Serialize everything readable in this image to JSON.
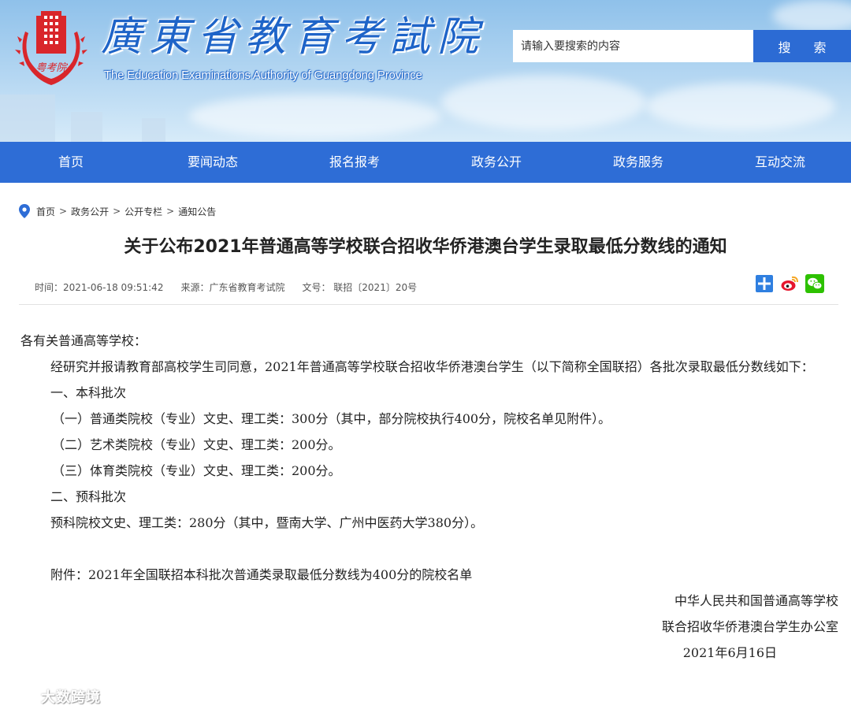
{
  "header": {
    "logo_cn": "廣東省教育考試院",
    "logo_en": "The Education Examinations Authority of Guangdong Province",
    "seal_text": "粤考院",
    "search": {
      "placeholder": "请输入要搜索的内容",
      "button_label": "搜 索"
    }
  },
  "nav": {
    "items": [
      {
        "label": "首页"
      },
      {
        "label": "要闻动态"
      },
      {
        "label": "报名报考"
      },
      {
        "label": "政务公开"
      },
      {
        "label": "政务服务"
      },
      {
        "label": "互动交流"
      }
    ]
  },
  "breadcrumb": {
    "items": [
      {
        "label": "首页"
      },
      {
        "label": "政务公开"
      },
      {
        "label": "公开专栏"
      },
      {
        "label": "通知公告"
      }
    ],
    "separator": ">"
  },
  "article": {
    "title": "关于公布2021年普通高等学校联合招收华侨港澳台学生录取最低分数线的通知",
    "meta": {
      "time": "时间：2021-06-18 09:51:42",
      "source": "来源：广东省教育考试院",
      "doc_no": "文号： 联招〔2021〕20号"
    },
    "share": [
      "share-plus-icon",
      "weibo-icon",
      "wechat-icon"
    ],
    "salutation": "各有关普通高等学校：",
    "intro": "经研究并报请教育部高校学生司同意，2021年普通高等学校联合招收华侨港澳台学生（以下简称全国联招）各批次录取最低分数线如下：",
    "section1_title": "一、本科批次",
    "section1_items": [
      "（一）普通类院校（专业）文史、理工类：300分（其中，部分院校执行400分，院校名单见附件）。",
      "（二）艺术类院校（专业）文史、理工类：200分。",
      "（三）体育类院校（专业）文史、理工类：200分。"
    ],
    "section2_title": "二、预科批次",
    "section2_text": "预科院校文史、理工类：280分（其中，暨南大学、广州中医药大学380分）。",
    "attachment": "附件：2021年全国联招本科批次普通类录取最低分数线为400分的院校名单",
    "signature": [
      "中华人民共和国普通高等学校",
      "联合招收华侨港澳台学生办公室"
    ],
    "date": "2021年6月16日"
  },
  "watermark": {
    "text": "大数跨境"
  },
  "colors": {
    "nav_bg": "#2e6dd6",
    "search_btn": "#2c6bd4",
    "logo_text": "#1e64c8",
    "seal_red": "#d9262b"
  }
}
